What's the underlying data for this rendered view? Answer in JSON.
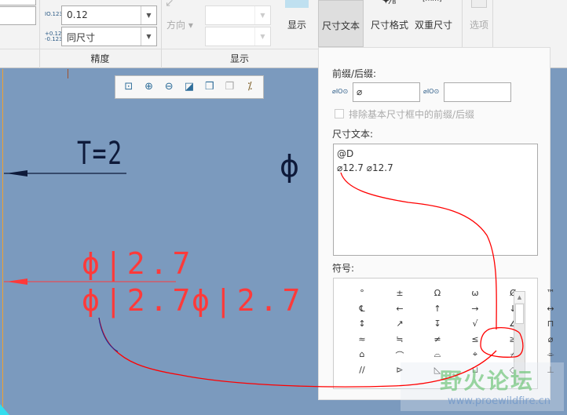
{
  "ribbon": {
    "precision_value": "0.12",
    "tolerance_value": "同尺寸",
    "precision_icon": "IO.123",
    "tolerance_icon": "+0.123 -0.123",
    "direction_label": "方向",
    "show_label": "显示",
    "dim_text_label": "尺寸文本",
    "dim_format_label": "尺寸格式",
    "dual_dim_label": "双重尺寸",
    "options_label": "选项",
    "group_precision": "精度",
    "group_show": "显示"
  },
  "canvas": {
    "note_text": "T=2",
    "phi_symbol": "ϕ",
    "dim_upper": "ϕ|2.7",
    "dim_lower": "ϕ|2.7",
    "dim_lower_extra": "ϕ|2.7",
    "toolbar_icons": [
      "refit-icon",
      "zoom-in-icon",
      "zoom-out-icon",
      "repaint-icon",
      "view-orientation-icon",
      "display-style-icon",
      "annotation-display-icon"
    ]
  },
  "panel": {
    "prefix_suffix_label": "前缀/后缀:",
    "prefix_icon": "⌀IO⊙",
    "prefix_value": "⌀",
    "suffix_icon": "⌀IO⊙",
    "suffix_value": "",
    "exclude_checkbox_label": "排除基本尺寸框中的前缀/后缀",
    "dim_text_label": "尺寸文本:",
    "dim_text_line1": "@D",
    "dim_text_line2": "⌀12.7 ⌀12.7",
    "symbols_label": "符号:",
    "symbols": [
      "°",
      "±",
      "Ω",
      "ω",
      "Ȼ",
      "™",
      "℄",
      "←",
      "↑",
      "→",
      "↓",
      "↔",
      "↕",
      "↗",
      "↧",
      "√",
      "∠",
      "⊓",
      "≈",
      "≒",
      "≠",
      "≤",
      "≥",
      "⌀",
      "⌂",
      "⌒",
      "⌓",
      "⌖",
      "⌿",
      "⌯",
      "//",
      "⊳",
      "◺",
      "⊔",
      "◇",
      "⊥"
    ]
  },
  "watermark": {
    "name": "野火论坛",
    "url": "www.proewildfire.cn"
  },
  "colors": {
    "canvas": "#7b9abe",
    "annotation_red": "#ff3030",
    "highlight_red": "#ff0000"
  }
}
